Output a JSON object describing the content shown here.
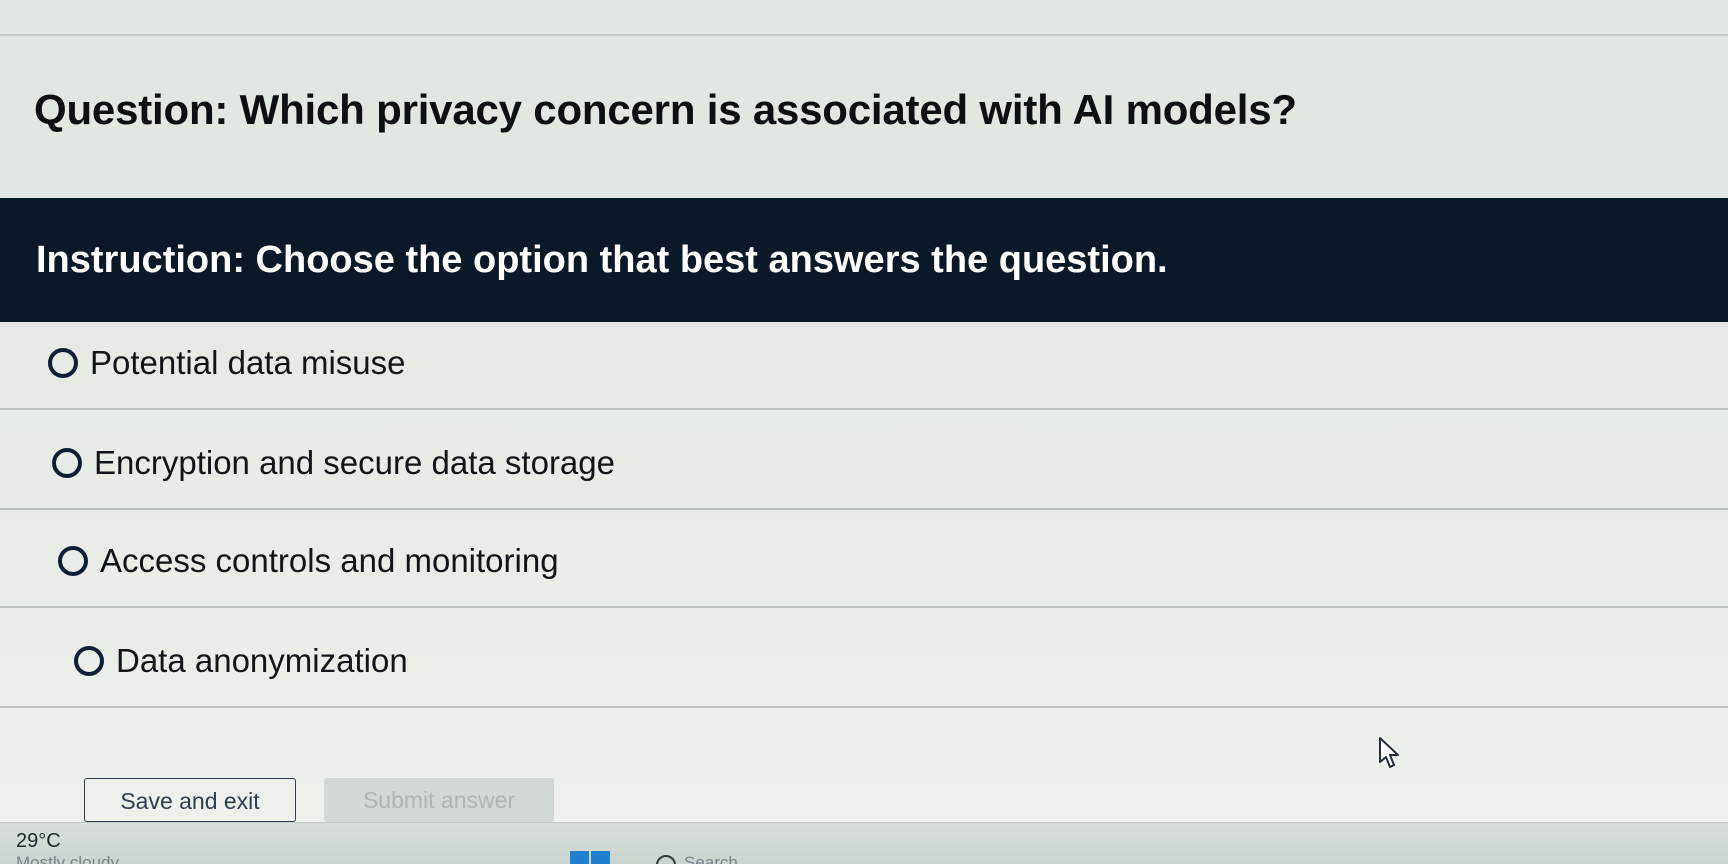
{
  "question": {
    "text": "Question: Which privacy concern is associated with AI models?"
  },
  "instruction": {
    "text": "Instruction: Choose the option that best answers the question."
  },
  "options": [
    {
      "label": "Potential data misuse"
    },
    {
      "label": "Encryption and secure data storage"
    },
    {
      "label": "Access controls and monitoring"
    },
    {
      "label": "Data anonymization"
    }
  ],
  "actions": {
    "save_label": "Save and exit",
    "submit_label": "Submit answer"
  },
  "taskbar": {
    "temperature": "29°C",
    "weather": "Mostly cloudy",
    "search_label": "Search",
    "start_icon": "windows-start-icon",
    "search_icon": "search-icon"
  },
  "colors": {
    "instruction_bar": "#0b1828",
    "radio_border": "#0d1f37",
    "start_blue": "#1f7fd1"
  }
}
